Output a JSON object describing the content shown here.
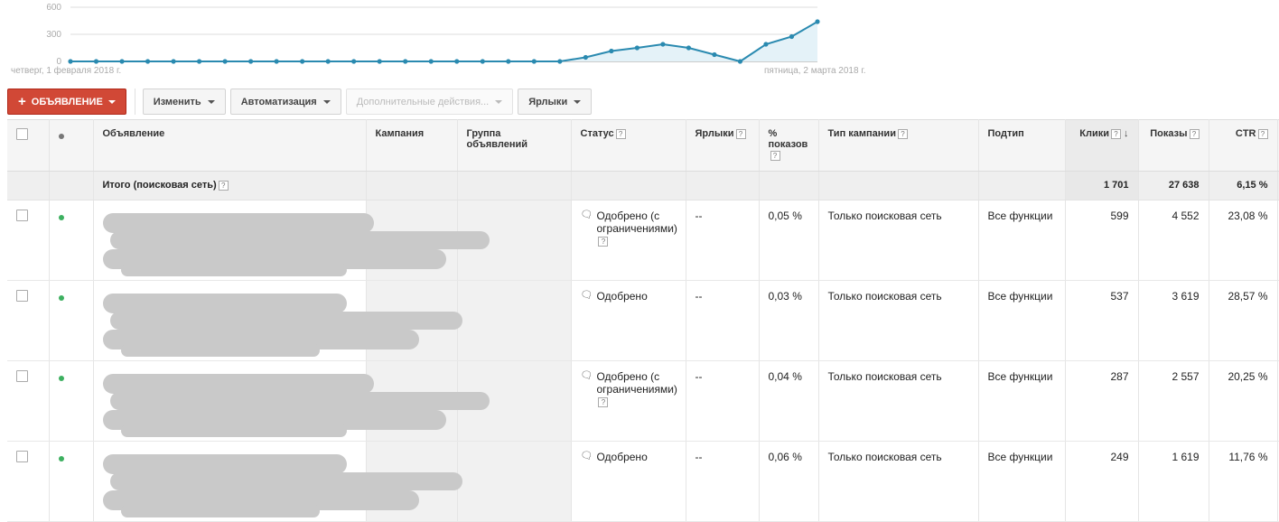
{
  "chart_data": {
    "type": "area",
    "ylim": [
      0,
      600
    ],
    "yticks": [
      0,
      300,
      600
    ],
    "start_label": "четверг, 1 февраля 2018 г.",
    "end_label": "пятница, 2 марта 2018 г.",
    "values": [
      0,
      0,
      0,
      0,
      0,
      0,
      0,
      0,
      0,
      0,
      0,
      0,
      0,
      0,
      0,
      0,
      0,
      0,
      0,
      0,
      45,
      115,
      150,
      190,
      150,
      75,
      0,
      190,
      275,
      440
    ],
    "color": "#2a8ab0"
  },
  "toolbar": {
    "add_label": "ОБЪЯВЛЕНИЕ",
    "edit_label": "Изменить",
    "automation_label": "Автоматизация",
    "more_label": "Дополнительные действия...",
    "labels_label": "Ярлыки"
  },
  "columns": {
    "ad": "Объявление",
    "campaign": "Кампания",
    "group": "Группа объявлений",
    "status": "Статус",
    "labels": "Ярлыки",
    "impr_share": "% показов",
    "campaign_type": "Тип кампании",
    "subtype": "Подтип",
    "clicks": "Клики",
    "impressions": "Показы",
    "ctr": "CTR"
  },
  "total": {
    "label": "Итого (поисковая сеть)",
    "clicks": "1 701",
    "impressions": "27 638",
    "ctr": "6,15 %"
  },
  "rows": [
    {
      "status": "Одобрено (с ограничениями)",
      "labels": "--",
      "impr_share": "0,05 %",
      "campaign_type": "Только поисковая сеть",
      "subtype": "Все функции",
      "clicks": "599",
      "impressions": "4 552",
      "ctr": "23,08 %",
      "limited": true
    },
    {
      "status": "Одобрено",
      "labels": "--",
      "impr_share": "0,03 %",
      "campaign_type": "Только поисковая сеть",
      "subtype": "Все функции",
      "clicks": "537",
      "impressions": "3 619",
      "ctr": "28,57 %",
      "limited": false
    },
    {
      "status": "Одобрено (с ограничениями)",
      "labels": "--",
      "impr_share": "0,04 %",
      "campaign_type": "Только поисковая сеть",
      "subtype": "Все функции",
      "clicks": "287",
      "impressions": "2 557",
      "ctr": "20,25 %",
      "limited": true
    },
    {
      "status": "Одобрено",
      "labels": "--",
      "impr_share": "0,06 %",
      "campaign_type": "Только поисковая сеть",
      "subtype": "Все функции",
      "clicks": "249",
      "impressions": "1 619",
      "ctr": "11,76 %",
      "limited": false
    }
  ]
}
